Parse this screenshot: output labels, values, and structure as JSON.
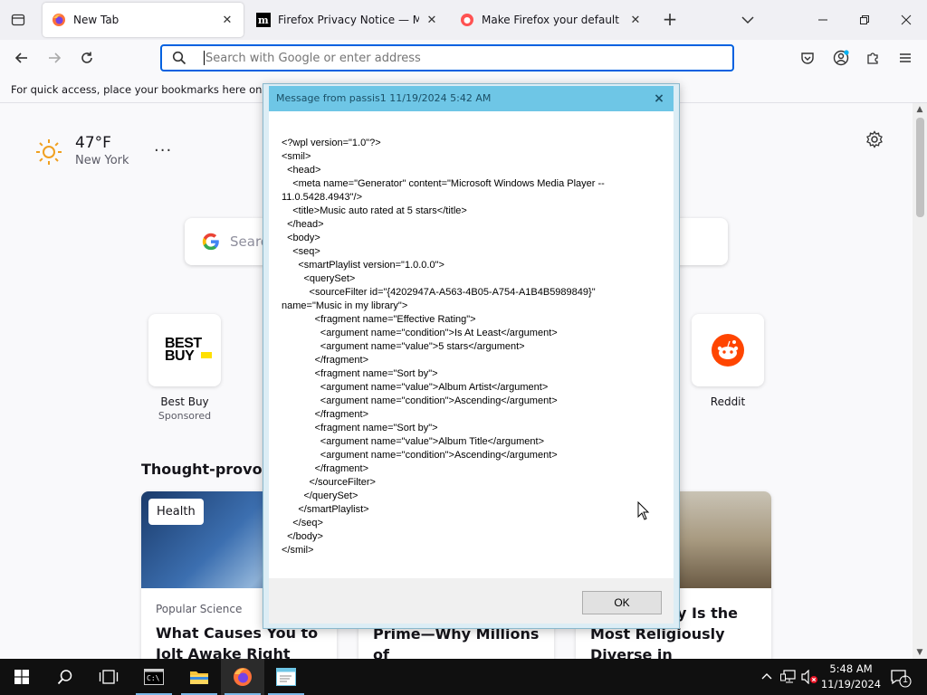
{
  "tabs": [
    {
      "title": "New Tab",
      "active": true
    },
    {
      "title": "Firefox Privacy Notice — Mozill",
      "active": false
    },
    {
      "title": "Make Firefox your default brow",
      "active": false
    }
  ],
  "urlbar": {
    "placeholder": "Search with Google or enter address"
  },
  "bookmarks_bar": {
    "text": "For quick access, place your bookmarks here on the b"
  },
  "weather": {
    "temp": "47°F",
    "city": "New York",
    "menu": "···"
  },
  "search": {
    "placeholder": "Search"
  },
  "shortcuts": [
    {
      "name": "Best Buy",
      "sub": "Sponsored",
      "logo": "BEST BUY"
    },
    {
      "name": "Reddit",
      "sub": ""
    }
  ],
  "stories_section": {
    "title": "Thought-provoking"
  },
  "stories": [
    {
      "badge": "Health",
      "source": "Popular Science",
      "headline": "What Causes You to Jolt Awake Right Before"
    },
    {
      "badge": "",
      "source": "",
      "headline": "Never Going Back to Prime—Why Millions of"
    },
    {
      "badge": "",
      "source": "",
      "headline": "This County Is the Most Religiously Diverse in"
    }
  ],
  "dialog": {
    "title": "Message from passis1 11/19/2024 5:42 AM",
    "close": "×",
    "body": "<?wpl version=\"1.0\"?>\n<smil>\n  <head>\n    <meta name=\"Generator\" content=\"Microsoft Windows Media Player --\n11.0.5428.4943\"/>\n    <title>Music auto rated at 5 stars</title>\n  </head>\n  <body>\n    <seq>\n      <smartPlaylist version=\"1.0.0.0\">\n        <querySet>\n          <sourceFilter id=\"{4202947A-A563-4B05-A754-A1B4B5989849}\"\nname=\"Music in my library\">\n            <fragment name=\"Effective Rating\">\n              <argument name=\"condition\">Is At Least</argument>\n              <argument name=\"value\">5 stars</argument>\n            </fragment>\n            <fragment name=\"Sort by\">\n              <argument name=\"value\">Album Artist</argument>\n              <argument name=\"condition\">Ascending</argument>\n            </fragment>\n            <fragment name=\"Sort by\">\n              <argument name=\"value\">Album Title</argument>\n              <argument name=\"condition\">Ascending</argument>\n            </fragment>\n          </sourceFilter>\n        </querySet>\n      </smartPlaylist>\n    </seq>\n  </body>\n</smil>",
    "ok_label": "OK"
  },
  "taskbar": {
    "time": "5:48 AM",
    "date": "11/19/2024",
    "notification_count": "1"
  },
  "colors": {
    "accent": "#0061e0",
    "dialog_titlebar": "#6ec6e6",
    "taskbar": "#101010"
  }
}
